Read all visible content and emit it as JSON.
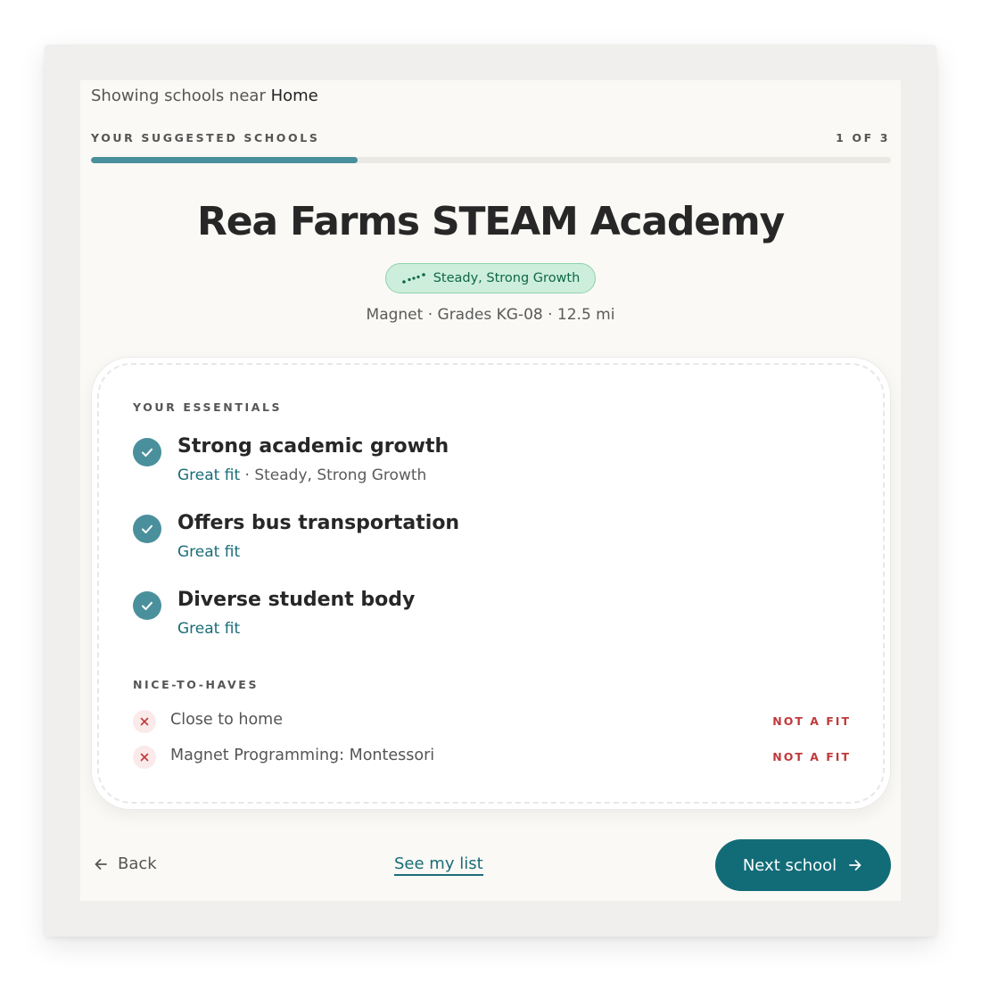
{
  "header": {
    "location_prefix": "Showing schools near",
    "location_name": "Home"
  },
  "progress": {
    "label": "YOUR SUGGESTED SCHOOLS",
    "count_text": "1 OF 3",
    "current": 1,
    "total": 3
  },
  "school": {
    "name": "Rea Farms STEAM Academy",
    "growth_badge": "Steady, Strong Growth",
    "growth_icon": "trend-dots-icon",
    "meta": "Magnet · Grades KG-08 · 12.5 mi"
  },
  "essentials": {
    "label": "YOUR ESSENTIALS",
    "items": [
      {
        "title": "Strong academic growth",
        "fit": "Great fit",
        "detail": "· Steady, Strong Growth"
      },
      {
        "title": "Offers bus transportation",
        "fit": "Great fit",
        "detail": ""
      },
      {
        "title": "Diverse student body",
        "fit": "Great fit",
        "detail": ""
      }
    ]
  },
  "nice_to_haves": {
    "label": "NICE-TO-HAVES",
    "items": [
      {
        "label": "Close to home",
        "status": "NOT A FIT"
      },
      {
        "label": "Magnet Programming: Montessori",
        "status": "NOT A FIT"
      }
    ]
  },
  "footer": {
    "back_label": "Back",
    "list_label": "See my list",
    "next_label": "Next school"
  },
  "colors": {
    "accent": "#126c78",
    "check": "#4a909c",
    "growth_bg": "#cdeedb",
    "growth_text": "#0f6845",
    "not_fit": "#c0393b"
  }
}
